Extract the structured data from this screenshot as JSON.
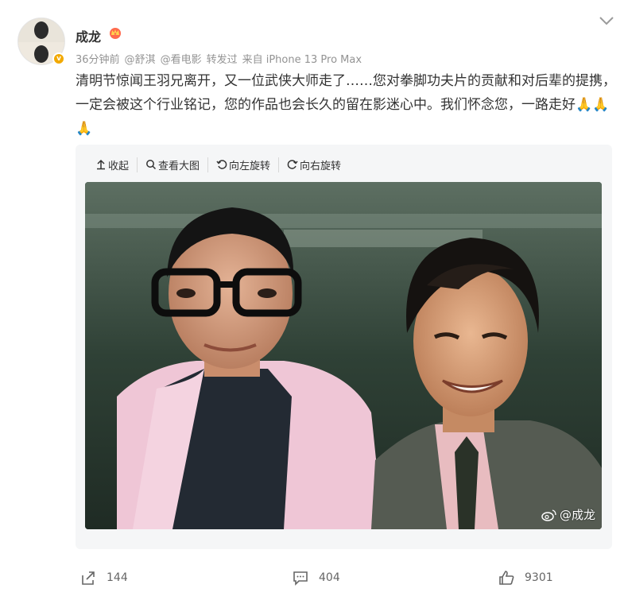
{
  "post": {
    "author": {
      "name": "成龙",
      "avatar_icon": "avatar-image",
      "verified_badge": "v"
    },
    "meta": {
      "time": "36分钟前",
      "tag1": "@舒淇",
      "tag2": "@看电影",
      "repost_text": "转发过",
      "source": "来自 iPhone 13 Pro Max"
    },
    "content": "清明节惊闻王羽兄离开，又一位武侠大师走了……您对拳脚功夫片的贡献和对后辈的提携，一定会被这个行业铭记，您的作品也会长久的留在影迷心中。我们怀念您，一路走好🙏🙏🙏"
  },
  "media_toolbar": {
    "collapse": "收起",
    "view_large": "查看大图",
    "rotate_left": "向左旋转",
    "rotate_right": "向右旋转"
  },
  "media": {
    "watermark": "@成龙"
  },
  "actions": {
    "share_count": "144",
    "comment_count": "404",
    "like_count": "9301"
  },
  "colors": {
    "badge": "#f2a900",
    "meta_text": "#939393",
    "media_bg": "#f5f6f7"
  }
}
